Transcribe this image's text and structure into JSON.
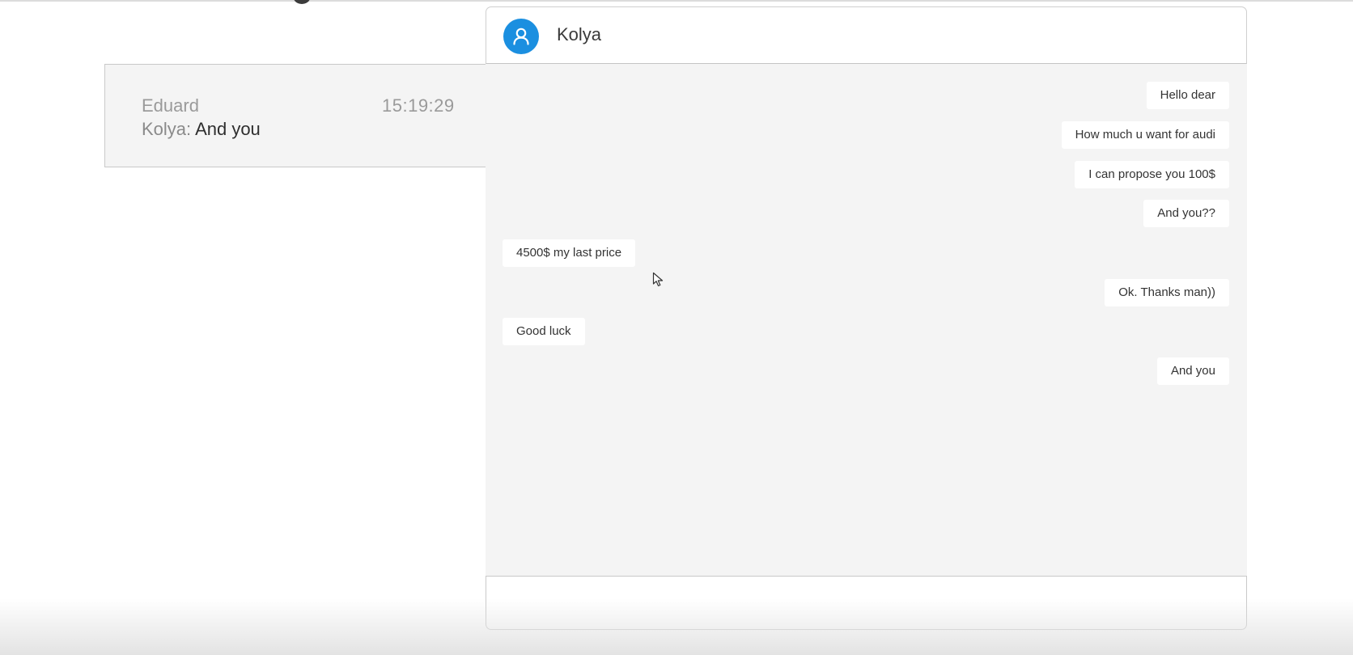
{
  "conversation_list": {
    "items": [
      {
        "name": "Eduard",
        "time": "15:19:29",
        "last_sender": "Kolya:",
        "last_message": "And you"
      }
    ]
  },
  "chat": {
    "contact_name": "Kolya",
    "avatar_icon": "user-icon",
    "accent_color": "#1b8fe0",
    "messages": [
      {
        "text": "Hello dear",
        "direction": "outgoing"
      },
      {
        "text": "How much u want for audi",
        "direction": "outgoing"
      },
      {
        "text": "I can propose you 100$",
        "direction": "outgoing"
      },
      {
        "text": "And you??",
        "direction": "outgoing"
      },
      {
        "text": "4500$ my last price",
        "direction": "incoming"
      },
      {
        "text": "Ok. Thanks man))",
        "direction": "outgoing"
      },
      {
        "text": "Good luck",
        "direction": "incoming"
      },
      {
        "text": "And you",
        "direction": "outgoing"
      }
    ],
    "composer": {
      "value": "",
      "placeholder": ""
    }
  }
}
